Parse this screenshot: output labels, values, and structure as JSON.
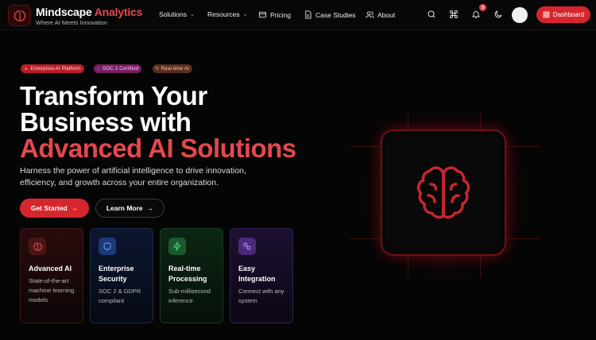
{
  "brand": {
    "name_part1": "Mindscape",
    "name_part2": "Analytics",
    "tagline": "Where AI Meets Innovation"
  },
  "nav": {
    "items": [
      {
        "label": "Solutions",
        "has_dropdown": true
      },
      {
        "label": "Resources",
        "has_dropdown": true
      },
      {
        "label": "Pricing",
        "icon": "card-icon"
      },
      {
        "label": "Case Studies",
        "icon": "document-icon"
      },
      {
        "label": "About",
        "icon": "users-icon"
      }
    ],
    "notification_count": "3",
    "dashboard_label": "Dashboard"
  },
  "hero": {
    "badges": [
      {
        "label": "Enterprise AI Platform",
        "icon": "sparkle-icon"
      },
      {
        "label": "SOC 2 Certified",
        "icon": "shield-icon"
      },
      {
        "label": "Real-time AI",
        "icon": "bolt-icon"
      }
    ],
    "title_line1": "Transform Your",
    "title_line2": "Business with",
    "title_line3": "Advanced AI Solutions",
    "subtitle_line1": "Harness the power of artificial intelligence to drive innovation,",
    "subtitle_line2": "efficiency, and growth across your entire organization.",
    "primary_cta": "Get Started",
    "secondary_cta": "Learn More"
  },
  "features": [
    {
      "title": "Advanced AI",
      "desc": "State-of-the-art machine learning models",
      "icon": "brain-icon",
      "accent": "#e5484d"
    },
    {
      "title": "Enterprise Security",
      "desc": "SOC 2 & GDPR compliant",
      "icon": "shield-icon",
      "accent": "#4b7bff"
    },
    {
      "title": "Real-time Processing",
      "desc": "Sub-millisecond inference",
      "icon": "bolt-icon",
      "accent": "#3ecf6b"
    },
    {
      "title": "Easy Integration",
      "desc": "Connect with any system",
      "icon": "link-icon",
      "accent": "#a070ff"
    }
  ],
  "colors": {
    "accent": "#e5484d",
    "button": "#d6262d",
    "background": "#050505"
  }
}
